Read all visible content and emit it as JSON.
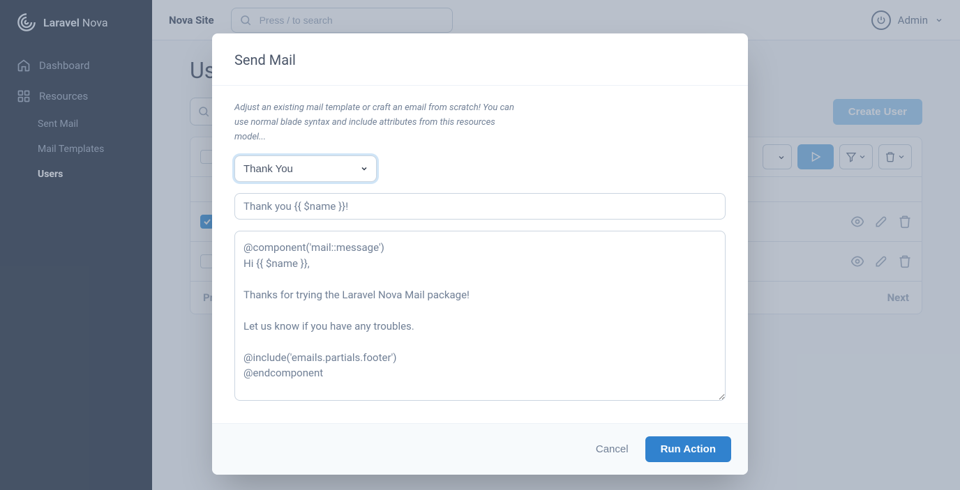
{
  "brand": {
    "name_a": "Laravel",
    "name_b": "Nova"
  },
  "site_name": "Nova Site",
  "search": {
    "placeholder": "Press / to search"
  },
  "user": {
    "name": "Admin"
  },
  "nav": {
    "dashboard": "Dashboard",
    "resources": "Resources",
    "sent_mail": "Sent Mail",
    "mail_templates": "Mail Templates",
    "users": "Users"
  },
  "page": {
    "title": "Users",
    "create_button": "Create User",
    "prev": "Previous",
    "next": "Next"
  },
  "modal": {
    "title": "Send Mail",
    "help": "Adjust an existing mail template or craft an email from scratch! You can use normal blade syntax and include attributes from this resources model...",
    "template_selected": "Thank You",
    "subject": "Thank you {{ $name }}!",
    "body": "@component('mail::message')\nHi {{ $name }},\n\nThanks for trying the Laravel Nova Mail package!\n\nLet us know if you have any troubles.\n\n@include('emails.partials.footer')\n@endcomponent",
    "cancel": "Cancel",
    "run": "Run Action"
  }
}
